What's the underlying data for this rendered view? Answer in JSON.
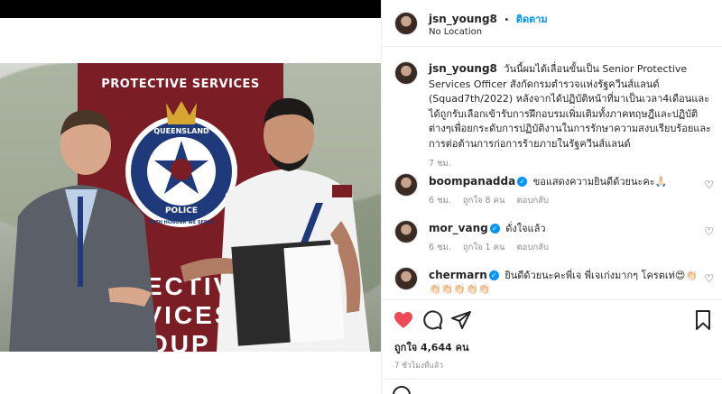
{
  "post": {
    "username": "jsn_young8",
    "follow_label": "ติดตาม",
    "follow_separator": "•",
    "location": "No Location"
  },
  "photo": {
    "banner_title": "PROTECTIVE SERVICES",
    "crest_top": "QUEENSLAND",
    "crest_bottom": "POLICE",
    "crest_motto": "WITH HONOUR WE SERVE",
    "banner_group_line1": "OTECTIVE",
    "banner_group_line2": "ERVICES",
    "banner_group_line3": "GROUP"
  },
  "caption": {
    "username": "jsn_young8",
    "text": "วันนี้ผมได้เลื่อนขั้นเป็น Senior Protective Services Officer สังกัดกรมตำรวจแห่งรัฐควีนส์แลนด์ (Squad7th/2022) หลังจากได้ปฏิบัติหน้าที่มาเป็นเวลา4เดือนและได้ถูกรับเลือกเข้ารับการฝึกอบรมเพิ่มเติมทั้งภาคทฤษฎีและปฏิบัติต่างๆเพื่อยกระดับการปฏิบัติงานในการรักษาความสงบเรียบร้อยและการต่อต้านการก่อการร้ายภายในรัฐควีนส์แลนด์",
    "time": "7 ชม."
  },
  "comments": [
    {
      "username": "boompanadda",
      "text": "ขอแสดงความยินดีด้วยนะคะ🙏🏻",
      "time": "6 ชม.",
      "likes": "ถูกใจ 8 คน",
      "reply": "ตอบกลับ"
    },
    {
      "username": "mor_vang",
      "text": "ดั่งใจแล้ว",
      "time": "6 ชม.",
      "likes": "ถูกใจ 1 คน",
      "reply": "ตอบกลับ"
    },
    {
      "username": "chermarn",
      "text": "ยินดีด้วยนะคะพี่เจ พี่เจเก่งมากๆ โครตเท่😍👏🏻👏🏻👏🏻👏🏻👏🏻👏🏻"
    }
  ],
  "footer": {
    "likes": "ถูกใจ 4,644 คน",
    "time": "7 ชั่วโมงที่แล้ว"
  },
  "icons": {
    "heart": "heart-filled-icon",
    "comment": "comment-icon",
    "share": "share-icon",
    "save": "bookmark-icon"
  },
  "colors": {
    "like_red": "#ed4956",
    "link_blue": "#0095f6",
    "banner_maroon": "#7a1d24"
  }
}
